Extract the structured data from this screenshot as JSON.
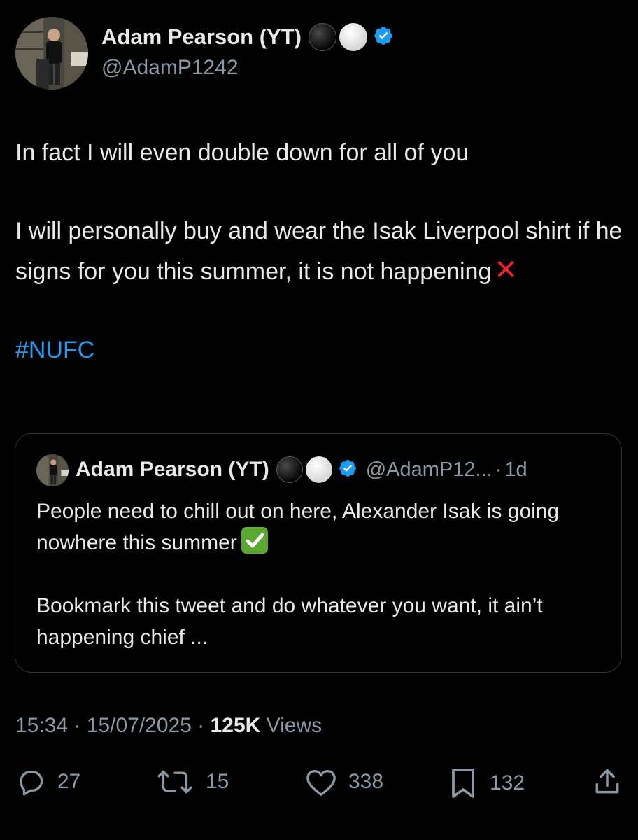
{
  "author": {
    "display_name": "Adam Pearson (YT)",
    "handle": "@AdamP1242",
    "badges": [
      "black-circle-icon",
      "white-circle-icon",
      "verified-badge-icon"
    ]
  },
  "tweet": {
    "paragraphs": [
      "In fact I will even double down for all of you",
      "I will personally buy and wear the Isak Liverpool shirt if he signs for you this summer, it is not happening"
    ],
    "end_emoji": "cross-mark-icon",
    "hashtag": "#NUFC"
  },
  "quoted": {
    "display_name": "Adam Pearson (YT)",
    "handle": "@AdamP12...",
    "separator": "·",
    "time": "1d",
    "paragraphs": [
      "People need to chill out on here, Alexander Isak is going nowhere this summer",
      "Bookmark this tweet and do whatever you want, it ain’t happening chief ..."
    ],
    "emoji": "check-mark-button-icon"
  },
  "meta": {
    "time": "15:34",
    "sep1": "·",
    "date": "15/07/2025",
    "sep2": "·",
    "views_count": "125K",
    "views_label": "Views"
  },
  "actions": {
    "replies": "27",
    "retweets": "15",
    "likes": "338",
    "bookmarks": "132"
  },
  "colors": {
    "background": "#000000",
    "text": "#e7e9ea",
    "secondary": "#8b98a5",
    "link": "#1d9bf0",
    "verified": "#1d9bf0",
    "border": "#2f3336"
  }
}
